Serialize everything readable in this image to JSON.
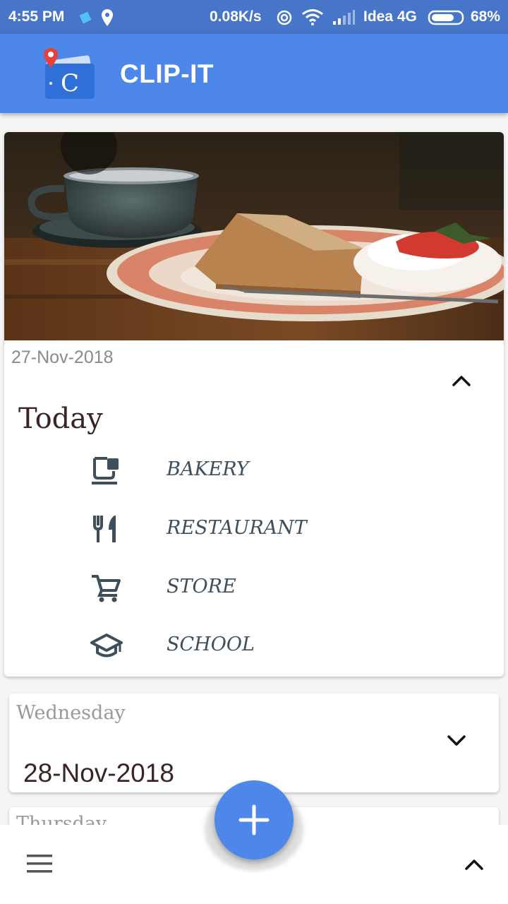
{
  "status_bar": {
    "time": "4:55 PM",
    "net_speed": "0.08K/s",
    "carrier": "Idea 4G",
    "battery": "68%"
  },
  "app_bar": {
    "title": "CLIP-IT",
    "logo_letter": "C",
    "color": "#4d87ea"
  },
  "today_card": {
    "date": "27-Nov-2018",
    "heading": "Today",
    "expanded": true,
    "categories": [
      {
        "label": "BAKERY",
        "icon": "coffee-cup-icon"
      },
      {
        "label": "RESTAURANT",
        "icon": "fork-knife-icon"
      },
      {
        "label": "STORE",
        "icon": "shopping-cart-icon"
      },
      {
        "label": "SCHOOL",
        "icon": "graduation-cap-icon"
      }
    ]
  },
  "day_cards": [
    {
      "day": "Wednesday",
      "date": "28-Nov-2018",
      "expanded": false
    },
    {
      "day": "Thursday"
    }
  ],
  "bottom_bar": {
    "menu_icon": "hamburger-menu-icon",
    "fab_icon": "plus-icon",
    "right_icon": "chevron-up-icon"
  }
}
